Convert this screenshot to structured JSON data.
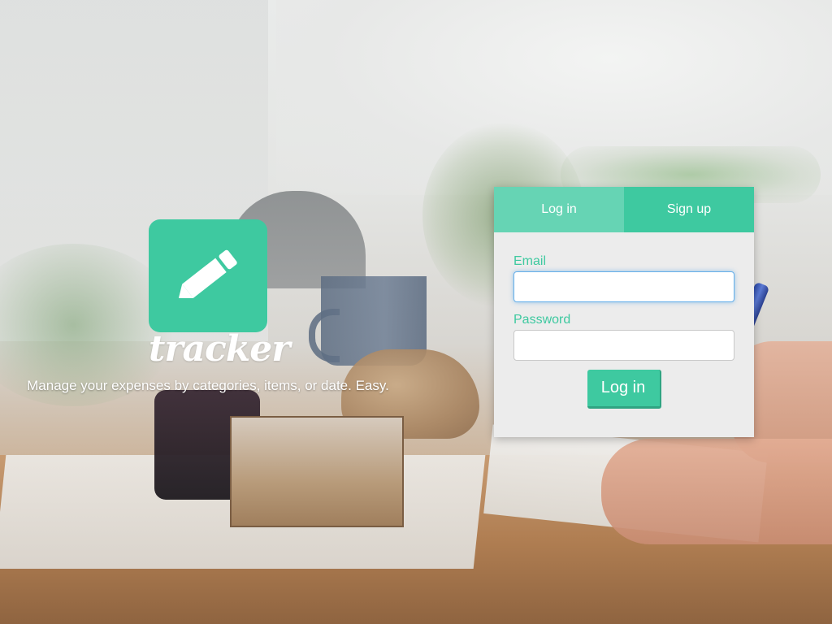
{
  "brand": {
    "name": "tracker",
    "tagline": "Manage your expenses by categories, items, or date. Easy.",
    "logo_icon": "pencil-icon",
    "accent_color": "#3ec9a0"
  },
  "auth": {
    "tabs": [
      {
        "label": "Log in",
        "active": true
      },
      {
        "label": "Sign up",
        "active": false
      }
    ],
    "fields": {
      "email_label": "Email",
      "email_value": "",
      "password_label": "Password",
      "password_value": ""
    },
    "submit_label": "Log in"
  }
}
